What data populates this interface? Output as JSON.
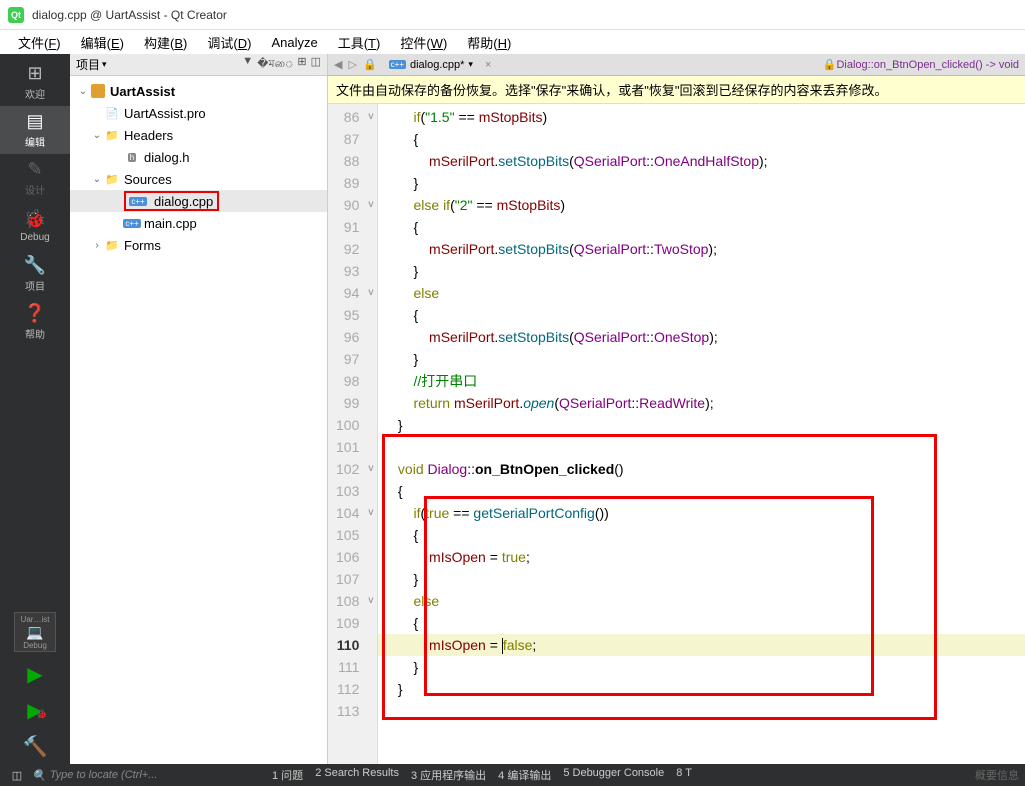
{
  "window": {
    "title": "dialog.cpp @ UartAssist - Qt Creator"
  },
  "menu": {
    "file": "文件(F)",
    "edit": "编辑(E)",
    "build": "构建(B)",
    "debug": "调试(D)",
    "analyze": "Analyze",
    "tools": "工具(T)",
    "widgets": "控件(W)",
    "help": "帮助(H)"
  },
  "leftbar": {
    "welcome": "欢迎",
    "edit": "编辑",
    "design": "设计",
    "debug": "Debug",
    "projects": "项目",
    "help": "帮助",
    "target": "Uar…ist",
    "targetDebug": "Debug"
  },
  "sidebar": {
    "header": "项目",
    "tree": {
      "root": "UartAssist",
      "pro": "UartAssist.pro",
      "headers": "Headers",
      "dialogh": "dialog.h",
      "sources": "Sources",
      "dialogcpp": "dialog.cpp",
      "maincpp": "main.cpp",
      "forms": "Forms"
    }
  },
  "editor": {
    "tab": "dialog.cpp*",
    "breadcrumb": "Dialog::on_BtnOpen_clicked() -> void",
    "warning": "文件由自动保存的备份恢复。选择\"保存\"来确认，或者\"恢复\"回滚到已经保存的内容来丢弃修改。",
    "lines": [
      {
        "n": 86,
        "fold": "v",
        "html": "        <span class='kw'>if</span>(<span class='str'>\"1.5\"</span> == <span class='mem'>mStopBits</span>)"
      },
      {
        "n": 87,
        "html": "        {"
      },
      {
        "n": 88,
        "html": "            <span class='mem'>mSerilPort</span>.<span class='meth'>setStopBits</span>(<span class='type'>QSerialPort</span>::<span class='type'>OneAndHalfStop</span>);"
      },
      {
        "n": 89,
        "html": "        }"
      },
      {
        "n": 90,
        "fold": "v",
        "html": "        <span class='kw'>else</span> <span class='kw'>if</span>(<span class='str'>\"2\"</span> == <span class='mem'>mStopBits</span>)"
      },
      {
        "n": 91,
        "html": "        {"
      },
      {
        "n": 92,
        "html": "            <span class='mem'>mSerilPort</span>.<span class='meth'>setStopBits</span>(<span class='type'>QSerialPort</span>::<span class='type'>TwoStop</span>);"
      },
      {
        "n": 93,
        "html": "        }"
      },
      {
        "n": 94,
        "fold": "v",
        "html": "        <span class='kw'>else</span>"
      },
      {
        "n": 95,
        "html": "        {"
      },
      {
        "n": 96,
        "html": "            <span class='mem'>mSerilPort</span>.<span class='meth'>setStopBits</span>(<span class='type'>QSerialPort</span>::<span class='type'>OneStop</span>);"
      },
      {
        "n": 97,
        "html": "        }"
      },
      {
        "n": 98,
        "html": "        <span class='cmt'>//打开串口</span>"
      },
      {
        "n": 99,
        "html": "        <span class='kw'>return</span> <span class='mem'>mSerilPort</span>.<span class='fn'>open</span>(<span class='type'>QSerialPort</span>::<span class='type'>ReadWrite</span>);"
      },
      {
        "n": 100,
        "html": "    }"
      },
      {
        "n": 101,
        "html": ""
      },
      {
        "n": 102,
        "fold": "v",
        "html": "    <span class='kw'>void</span> <span class='type'>Dialog</span>::<span class='bold'>on_BtnOpen_clicked</span>()"
      },
      {
        "n": 103,
        "html": "    {"
      },
      {
        "n": 104,
        "fold": "v",
        "html": "        <span class='kw'>if</span>(<span class='kw'>true</span> == <span class='meth'>getSerialPortConfig</span>())"
      },
      {
        "n": 105,
        "html": "        {"
      },
      {
        "n": 106,
        "html": "            <span class='mem'>mIsOpen</span> = <span class='kw'>true</span>;"
      },
      {
        "n": 107,
        "html": "        }"
      },
      {
        "n": 108,
        "fold": "v",
        "html": "        <span class='kw'>else</span>"
      },
      {
        "n": 109,
        "html": "        {"
      },
      {
        "n": 110,
        "cur": true,
        "html": "            <span class='mem'>mIsOpen</span> = <span class='cursor'></span><span class='kw'>false</span>;"
      },
      {
        "n": 111,
        "html": "        }"
      },
      {
        "n": 112,
        "html": "    }"
      },
      {
        "n": 113,
        "html": ""
      }
    ]
  },
  "status": {
    "locator": "Type to locate (Ctrl+...",
    "panes": [
      "1 问题",
      "2 Search Results",
      "3 应用程序输出",
      "4 编译输出",
      "5 Debugger Console",
      "8 T"
    ],
    "watermark": "概要信息"
  }
}
